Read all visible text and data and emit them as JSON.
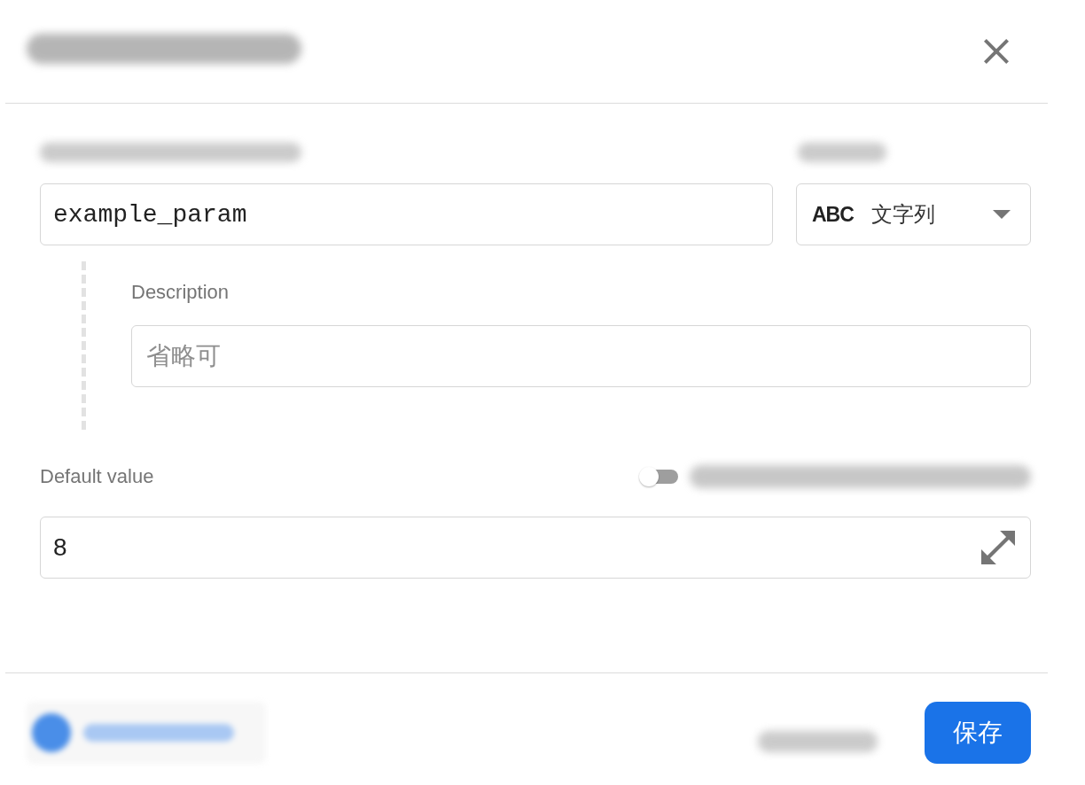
{
  "parameter": {
    "name_value": "example_param",
    "type_icon": "ABC",
    "type_value": "文字列"
  },
  "description": {
    "label": "Description",
    "placeholder": "省略可"
  },
  "default_value": {
    "label": "Default value",
    "toggle": {
      "on": false
    },
    "value": "8"
  },
  "footer": {
    "save_button": "保存"
  }
}
